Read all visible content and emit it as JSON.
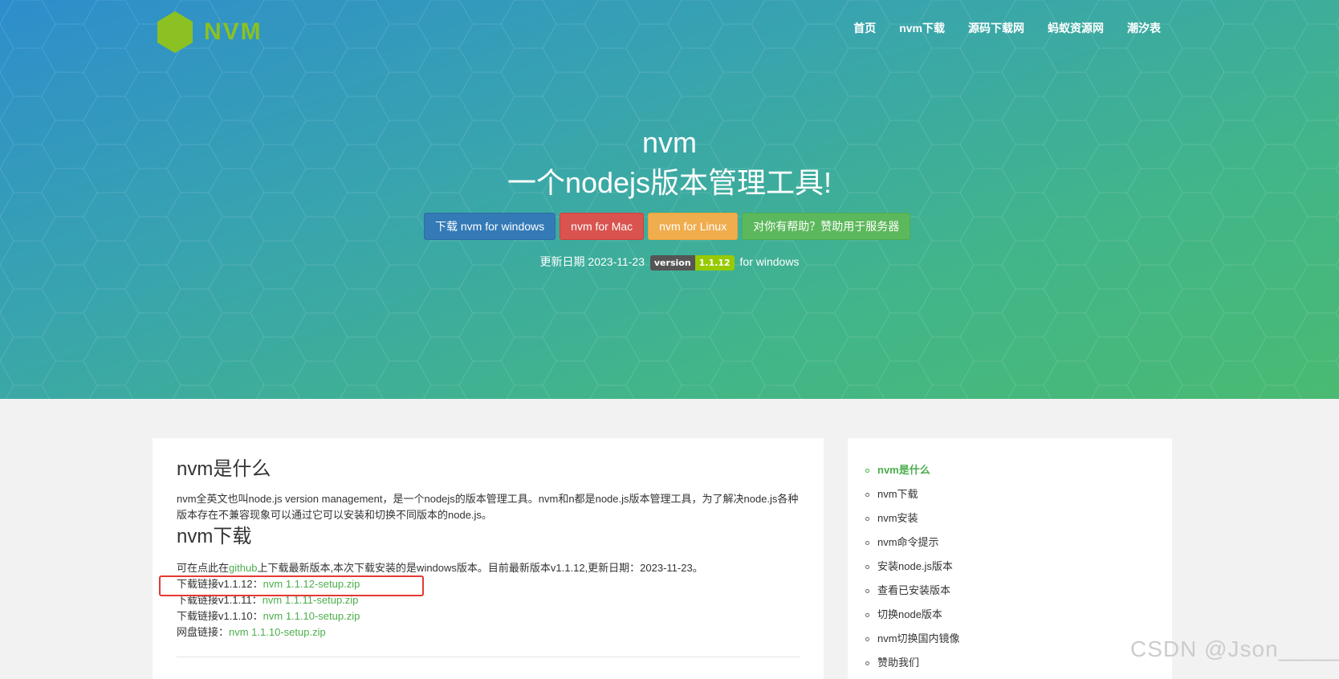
{
  "brand": {
    "name": "NVM",
    "logo_color": "#8bc122"
  },
  "nav": {
    "items": [
      {
        "label": "首页"
      },
      {
        "label": "nvm下载"
      },
      {
        "label": "源码下载网"
      },
      {
        "label": "蚂蚁资源网"
      },
      {
        "label": "潮汐表"
      }
    ]
  },
  "hero": {
    "title": "nvm",
    "subtitle": "一个nodejs版本管理工具!",
    "buttons": {
      "windows": "下载 nvm for windows",
      "mac": "nvm for Mac",
      "linux": "nvm for Linux",
      "donate": "对你有帮助？赞助用于服务器"
    },
    "update_label": "更新日期 2023-11-23",
    "badge_left": "version",
    "badge_right": "1.1.12",
    "update_suffix": "for windows"
  },
  "content": {
    "section1_title": "nvm是什么",
    "section1_text": "nvm全英文也叫node.js version management，是一个nodejs的版本管理工具。nvm和n都是node.js版本管理工具，为了解决node.js各种版本存在不兼容现象可以通过它可以安装和切换不同版本的node.js。",
    "section2_title": "nvm下载",
    "intro_prefix": "可在点此在",
    "intro_link": "github",
    "intro_suffix": "上下载最新版本,本次下载安装的是windows版本。目前最新版本v1.1.12,更新日期：2023-11-23。",
    "downloads": [
      {
        "label": "下载链接v1.1.12：",
        "link": "nvm 1.1.12-setup.zip"
      },
      {
        "label": "下载链接v1.1.11：",
        "link": "nvm 1.1.11-setup.zip"
      },
      {
        "label": "下载链接v1.1.10：",
        "link": "nvm 1.1.10-setup.zip"
      },
      {
        "label": "网盘链接：",
        "link": "nvm 1.1.10-setup.zip"
      }
    ]
  },
  "toc": {
    "items": [
      {
        "label": "nvm是什么"
      },
      {
        "label": "nvm下载"
      },
      {
        "label": "nvm安装"
      },
      {
        "label": "nvm命令提示"
      },
      {
        "label": "安装node.js版本"
      },
      {
        "label": "查看已安装版本"
      },
      {
        "label": "切换node版本"
      },
      {
        "label": "nvm切换国内镜像"
      },
      {
        "label": "赞助我们"
      }
    ]
  },
  "watermark": "CSDN @Json_____",
  "colors": {
    "accent_green": "#4cae4c",
    "highlight_red": "#e53935"
  }
}
